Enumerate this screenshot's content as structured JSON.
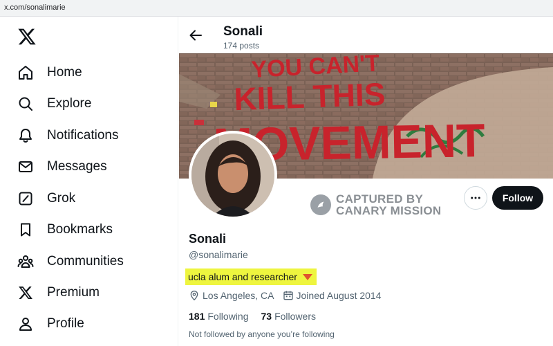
{
  "browser": {
    "url": "x.com/sonalimarie"
  },
  "sidebar": {
    "logo_icon": "x-logo-icon",
    "items": [
      {
        "label": "Home",
        "icon": "home-icon"
      },
      {
        "label": "Explore",
        "icon": "search-icon"
      },
      {
        "label": "Notifications",
        "icon": "bell-icon"
      },
      {
        "label": "Messages",
        "icon": "envelope-icon"
      },
      {
        "label": "Grok",
        "icon": "grok-icon"
      },
      {
        "label": "Bookmarks",
        "icon": "bookmark-icon"
      },
      {
        "label": "Communities",
        "icon": "communities-icon"
      },
      {
        "label": "Premium",
        "icon": "x-logo-icon"
      },
      {
        "label": "Profile",
        "icon": "person-icon"
      }
    ]
  },
  "header": {
    "name": "Sonali",
    "posts": "174 posts"
  },
  "banner": {
    "graffiti_lines": [
      "YOU CAN'T",
      "KILL THIS",
      "MOVEMENT"
    ]
  },
  "watermark": {
    "line1": "CAPTURED BY",
    "line2": "CANARY MISSION"
  },
  "profile": {
    "name": "Sonali",
    "handle": "@sonalimarie",
    "bio": "ucla alum and researcher",
    "location": "Los Angeles, CA",
    "joined": "Joined August 2014",
    "following_count": "181",
    "following_label": "Following",
    "followers_count": "73",
    "followers_label": "Followers",
    "not_followed": "Not followed by anyone you’re following"
  },
  "actions": {
    "follow_label": "Follow"
  },
  "colors": {
    "highlight": "#eef53f",
    "marker": "#e0532f",
    "graffiti": "#c8232c"
  }
}
